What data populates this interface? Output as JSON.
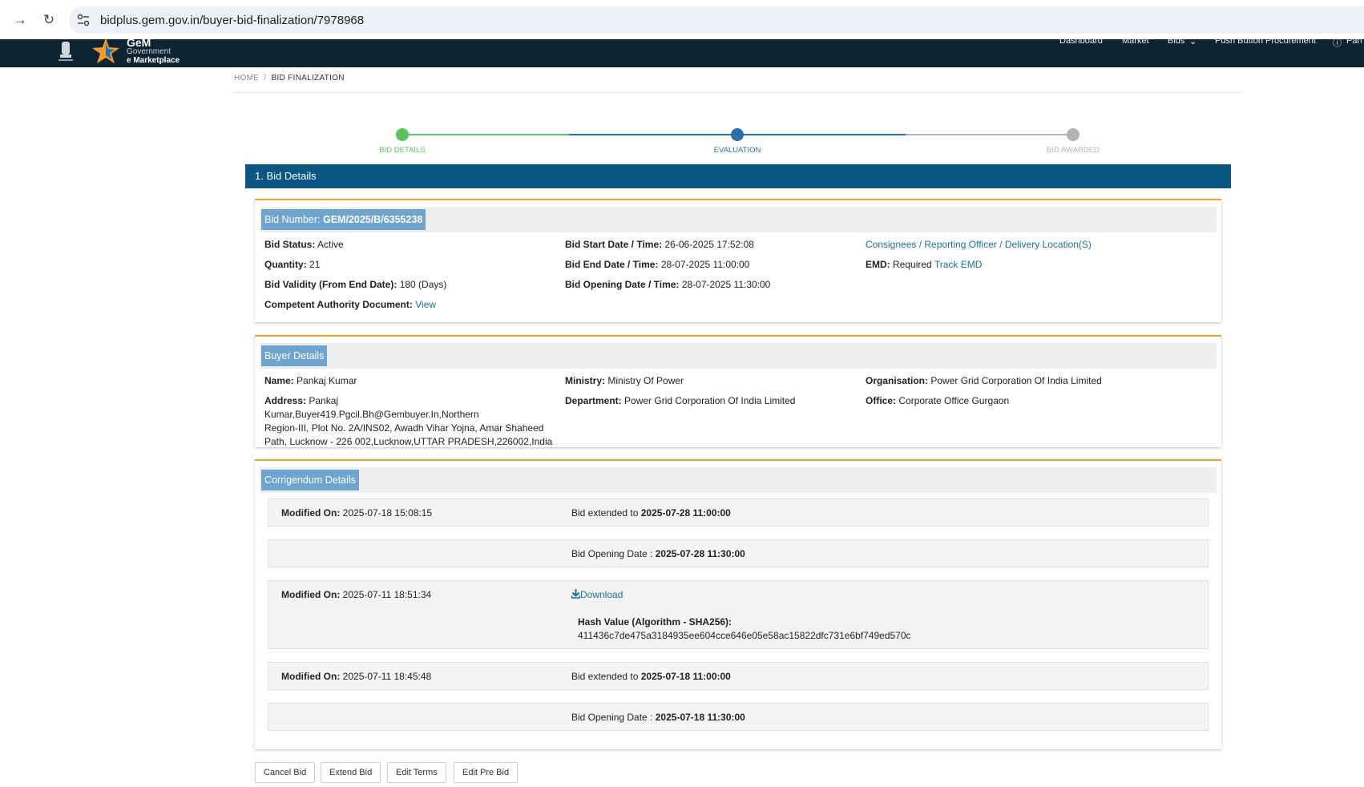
{
  "browser": {
    "url": "bidplus.gem.gov.in/buyer-bid-finalization/7978968"
  },
  "header": {
    "brand_top": "GeM",
    "brand_line1": "Government",
    "brand_line2": "e Marketplace",
    "nav": [
      "Dashboard",
      "Market",
      "Bids",
      "Push Button Procurement",
      "Pan"
    ]
  },
  "breadcrumb": {
    "home": "HOME",
    "sep": "/",
    "current": "BID FINALIZATION"
  },
  "stepper": {
    "steps": [
      {
        "label": "BID DETAILS",
        "color": "#5cc45c"
      },
      {
        "label": "EVALUATION",
        "color": "#2c6fad"
      },
      {
        "label": "BID AWARDED",
        "color": "#b4b4b4"
      }
    ]
  },
  "section": {
    "title": "1. Bid Details"
  },
  "bid": {
    "title_label": "Bid Number:",
    "title_value": "GEM/2025/B/6355238",
    "status_label": "Bid Status:",
    "status_value": "Active",
    "quantity_label": "Quantity:",
    "quantity_value": "21",
    "validity_label": "Bid Validity (From End Date):",
    "validity_value": "180 (Days)",
    "cad_label": "Competent Authority Document:",
    "cad_link": "View",
    "start_label": "Bid Start Date / Time:",
    "start_value": "26-06-2025 17:52:08",
    "end_label": "Bid End Date / Time:",
    "end_value": "28-07-2025 11:00:00",
    "opening_label": "Bid Opening Date / Time:",
    "opening_value": "28-07-2025 11:30:00",
    "consignees_link": "Consignees / Reporting Officer / Delivery Location(S)",
    "emd_label": "EMD:",
    "emd_value": "Required",
    "emd_link": "Track EMD"
  },
  "buyer": {
    "title": "Buyer Details",
    "name_label": "Name:",
    "name_value": "Pankaj Kumar",
    "address_label": "Address:",
    "address_line1": "Pankaj Kumar,Buyer419.Pgcil.Bh@Gembuyer.In,Northern",
    "address_line2": "Region-III, Plot No. 2A/INS02, Awadh Vihar Yojna, Amar Shaheed",
    "address_line3": "Path, Lucknow - 226 002,Lucknow,UTTAR PRADESH,226002,India",
    "ministry_label": "Ministry:",
    "ministry_value": "Ministry Of Power",
    "department_label": "Department:",
    "department_value": "Power Grid Corporation Of India Limited",
    "org_label": "Organisation:",
    "org_value": "Power Grid Corporation Of India Limited",
    "office_label": "Office:",
    "office_value": "Corporate Office Gurgaon"
  },
  "corrigendum": {
    "title": "Corrigendum Details",
    "modified_label": "Modified On:",
    "rows": [
      {
        "modified": "2025-07-18 15:08:15",
        "text": "Bid extended to",
        "value": "2025-07-28 11:00:00"
      },
      {
        "modified": "",
        "text": "Bid Opening Date :",
        "value": "2025-07-28 11:30:00"
      },
      {
        "modified": "2025-07-11 18:51:34",
        "download": "Download",
        "hash_label": "Hash Value (Algorithm - SHA256):",
        "hash_value": "411436c7de475a3184935ee604cce646e05e58ac15822dfc731e6bf749ed570c"
      },
      {
        "modified": "2025-07-11 18:45:48",
        "text": "Bid extended to",
        "value": "2025-07-18 11:00:00"
      },
      {
        "modified": "",
        "text": "Bid Opening Date :",
        "value": "2025-07-18 11:30:00"
      }
    ]
  },
  "actions": {
    "cancel": "Cancel Bid",
    "extend": "Extend Bid",
    "edit_terms": "Edit Terms",
    "edit_pre_bid": "Edit Pre Bid"
  }
}
